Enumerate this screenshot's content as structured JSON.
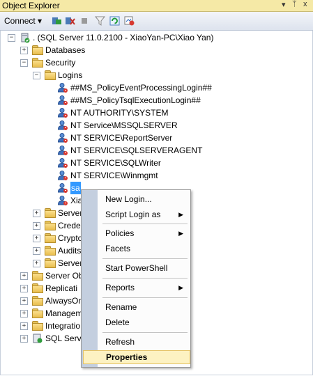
{
  "window": {
    "title": "Object Explorer",
    "pin_glyph": "▾",
    "close_glyph": "x",
    "pin2_glyph": "ᛘ"
  },
  "toolbar": {
    "connect_label": "Connect ▾"
  },
  "tree": {
    "server": ". (SQL Server 11.0.2100 - XiaoYan-PC\\Xiao Yan)",
    "databases": "Databases",
    "security": "Security",
    "logins": "Logins",
    "login_items": [
      "##MS_PolicyEventProcessingLogin##",
      "##MS_PolicyTsqlExecutionLogin##",
      "NT AUTHORITY\\SYSTEM",
      "NT Service\\MSSQLSERVER",
      "NT SERVICE\\ReportServer",
      "NT SERVICE\\SQLSERVERAGENT",
      "NT SERVICE\\SQLWriter",
      "NT SERVICE\\Winmgmt",
      "sa",
      "Xia"
    ],
    "security_children": [
      "Server",
      "Crede",
      "Crypto",
      "Audits",
      "Server"
    ],
    "top_level": [
      "Server Ob",
      "Replicati",
      "AlwaysOn",
      "Managem",
      "Integratio",
      "SQL Serve"
    ]
  },
  "context_menu": {
    "new_login": "New Login...",
    "script_login": "Script Login as",
    "policies": "Policies",
    "facets": "Facets",
    "powershell": "Start PowerShell",
    "reports": "Reports",
    "rename": "Rename",
    "delete": "Delete",
    "refresh": "Refresh",
    "properties": "Properties"
  }
}
